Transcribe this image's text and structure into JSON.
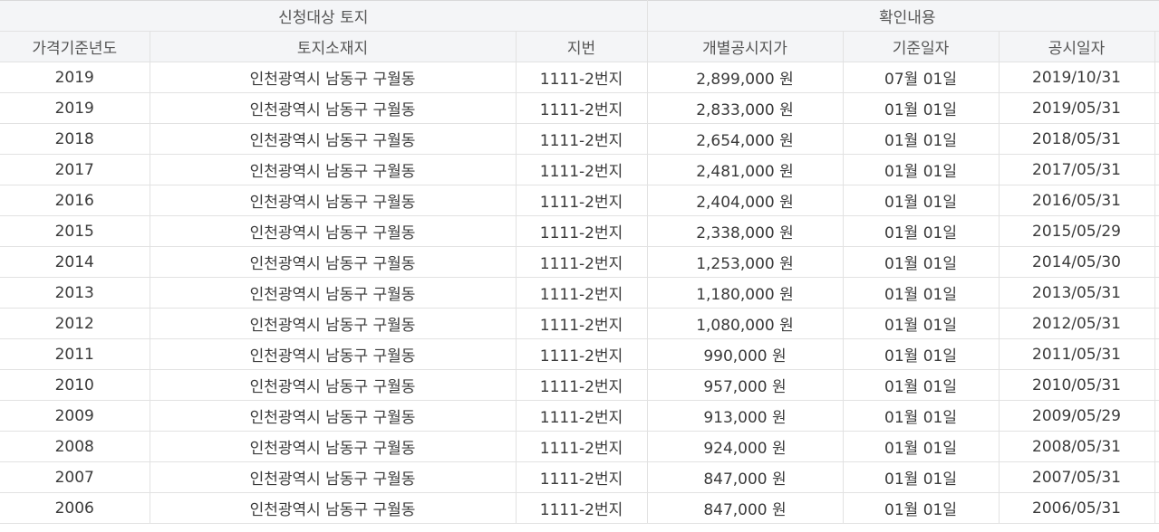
{
  "table": {
    "group_headers": [
      {
        "label": "신청대상 토지",
        "span": 3
      },
      {
        "label": "확인내용",
        "span": 3
      }
    ],
    "columns": [
      "가격기준년도",
      "토지소재지",
      "지번",
      "개별공시지가",
      "기준일자",
      "공시일자"
    ],
    "rows": [
      [
        "2019",
        "인천광역시 남동구 구월동",
        "1111-2번지",
        "2,899,000 원",
        "07월 01일",
        "2019/10/31"
      ],
      [
        "2019",
        "인천광역시 남동구 구월동",
        "1111-2번지",
        "2,833,000 원",
        "01월 01일",
        "2019/05/31"
      ],
      [
        "2018",
        "인천광역시 남동구 구월동",
        "1111-2번지",
        "2,654,000 원",
        "01월 01일",
        "2018/05/31"
      ],
      [
        "2017",
        "인천광역시 남동구 구월동",
        "1111-2번지",
        "2,481,000 원",
        "01월 01일",
        "2017/05/31"
      ],
      [
        "2016",
        "인천광역시 남동구 구월동",
        "1111-2번지",
        "2,404,000 원",
        "01월 01일",
        "2016/05/31"
      ],
      [
        "2015",
        "인천광역시 남동구 구월동",
        "1111-2번지",
        "2,338,000 원",
        "01월 01일",
        "2015/05/29"
      ],
      [
        "2014",
        "인천광역시 남동구 구월동",
        "1111-2번지",
        "1,253,000 원",
        "01월 01일",
        "2014/05/30"
      ],
      [
        "2013",
        "인천광역시 남동구 구월동",
        "1111-2번지",
        "1,180,000 원",
        "01월 01일",
        "2013/05/31"
      ],
      [
        "2012",
        "인천광역시 남동구 구월동",
        "1111-2번지",
        "1,080,000 원",
        "01월 01일",
        "2012/05/31"
      ],
      [
        "2011",
        "인천광역시 남동구 구월동",
        "1111-2번지",
        "990,000 원",
        "01월 01일",
        "2011/05/31"
      ],
      [
        "2010",
        "인천광역시 남동구 구월동",
        "1111-2번지",
        "957,000 원",
        "01월 01일",
        "2010/05/31"
      ],
      [
        "2009",
        "인천광역시 남동구 구월동",
        "1111-2번지",
        "913,000 원",
        "01월 01일",
        "2009/05/29"
      ],
      [
        "2008",
        "인천광역시 남동구 구월동",
        "1111-2번지",
        "924,000 원",
        "01월 01일",
        "2008/05/31"
      ],
      [
        "2007",
        "인천광역시 남동구 구월동",
        "1111-2번지",
        "847,000 원",
        "01월 01일",
        "2007/05/31"
      ],
      [
        "2006",
        "인천광역시 남동구 구월동",
        "1111-2번지",
        "847,000 원",
        "01월 01일",
        "2006/05/31"
      ]
    ]
  }
}
